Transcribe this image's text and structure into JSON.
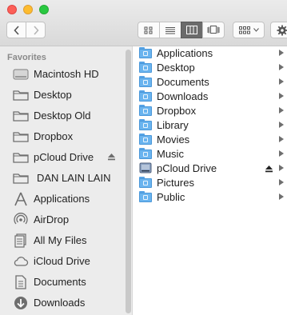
{
  "window": {
    "traffic": [
      "close",
      "minimize",
      "zoom"
    ]
  },
  "toolbar": {
    "back_icon": "chevron-left-icon",
    "forward_icon": "chevron-right-icon",
    "views": [
      "icon-view",
      "list-view",
      "column-view",
      "cover-flow-view"
    ],
    "active_view": "column-view",
    "arrange_icon": "arrange-grid-icon",
    "action_icon": "gear-icon"
  },
  "sidebar": {
    "heading": "Favorites",
    "items": [
      {
        "label": "Macintosh HD",
        "icon": "hard-drive-icon"
      },
      {
        "label": "Desktop",
        "icon": "folder-icon"
      },
      {
        "label": "Desktop Old",
        "icon": "folder-icon"
      },
      {
        "label": "Dropbox",
        "icon": "folder-icon"
      },
      {
        "label": "pCloud Drive",
        "icon": "folder-icon",
        "eject": true
      },
      {
        "label": "DAN LAIN LAIN",
        "icon": "folder-icon"
      },
      {
        "label": "Applications",
        "icon": "applications-icon"
      },
      {
        "label": "AirDrop",
        "icon": "airdrop-icon"
      },
      {
        "label": "All My Files",
        "icon": "all-files-icon"
      },
      {
        "label": "iCloud Drive",
        "icon": "cloud-icon"
      },
      {
        "label": "Documents",
        "icon": "documents-icon"
      },
      {
        "label": "Downloads",
        "icon": "downloads-icon"
      }
    ]
  },
  "column": {
    "items": [
      {
        "label": "Applications",
        "icon": "applications-folder-icon"
      },
      {
        "label": "Desktop",
        "icon": "desktop-folder-icon"
      },
      {
        "label": "Documents",
        "icon": "documents-folder-icon"
      },
      {
        "label": "Downloads",
        "icon": "downloads-folder-icon"
      },
      {
        "label": "Dropbox",
        "icon": "dropbox-folder-icon"
      },
      {
        "label": "Library",
        "icon": "library-folder-icon"
      },
      {
        "label": "Movies",
        "icon": "movies-folder-icon"
      },
      {
        "label": "Music",
        "icon": "music-folder-icon"
      },
      {
        "label": "pCloud Drive",
        "icon": "drive-icon",
        "eject": true
      },
      {
        "label": "Pictures",
        "icon": "pictures-folder-icon"
      },
      {
        "label": "Public",
        "icon": "public-folder-icon"
      }
    ]
  },
  "colors": {
    "folder_blue": "#6ab4ef",
    "sidebar_bg": "#ececec",
    "active_view_bg": "#6b6b6b"
  }
}
